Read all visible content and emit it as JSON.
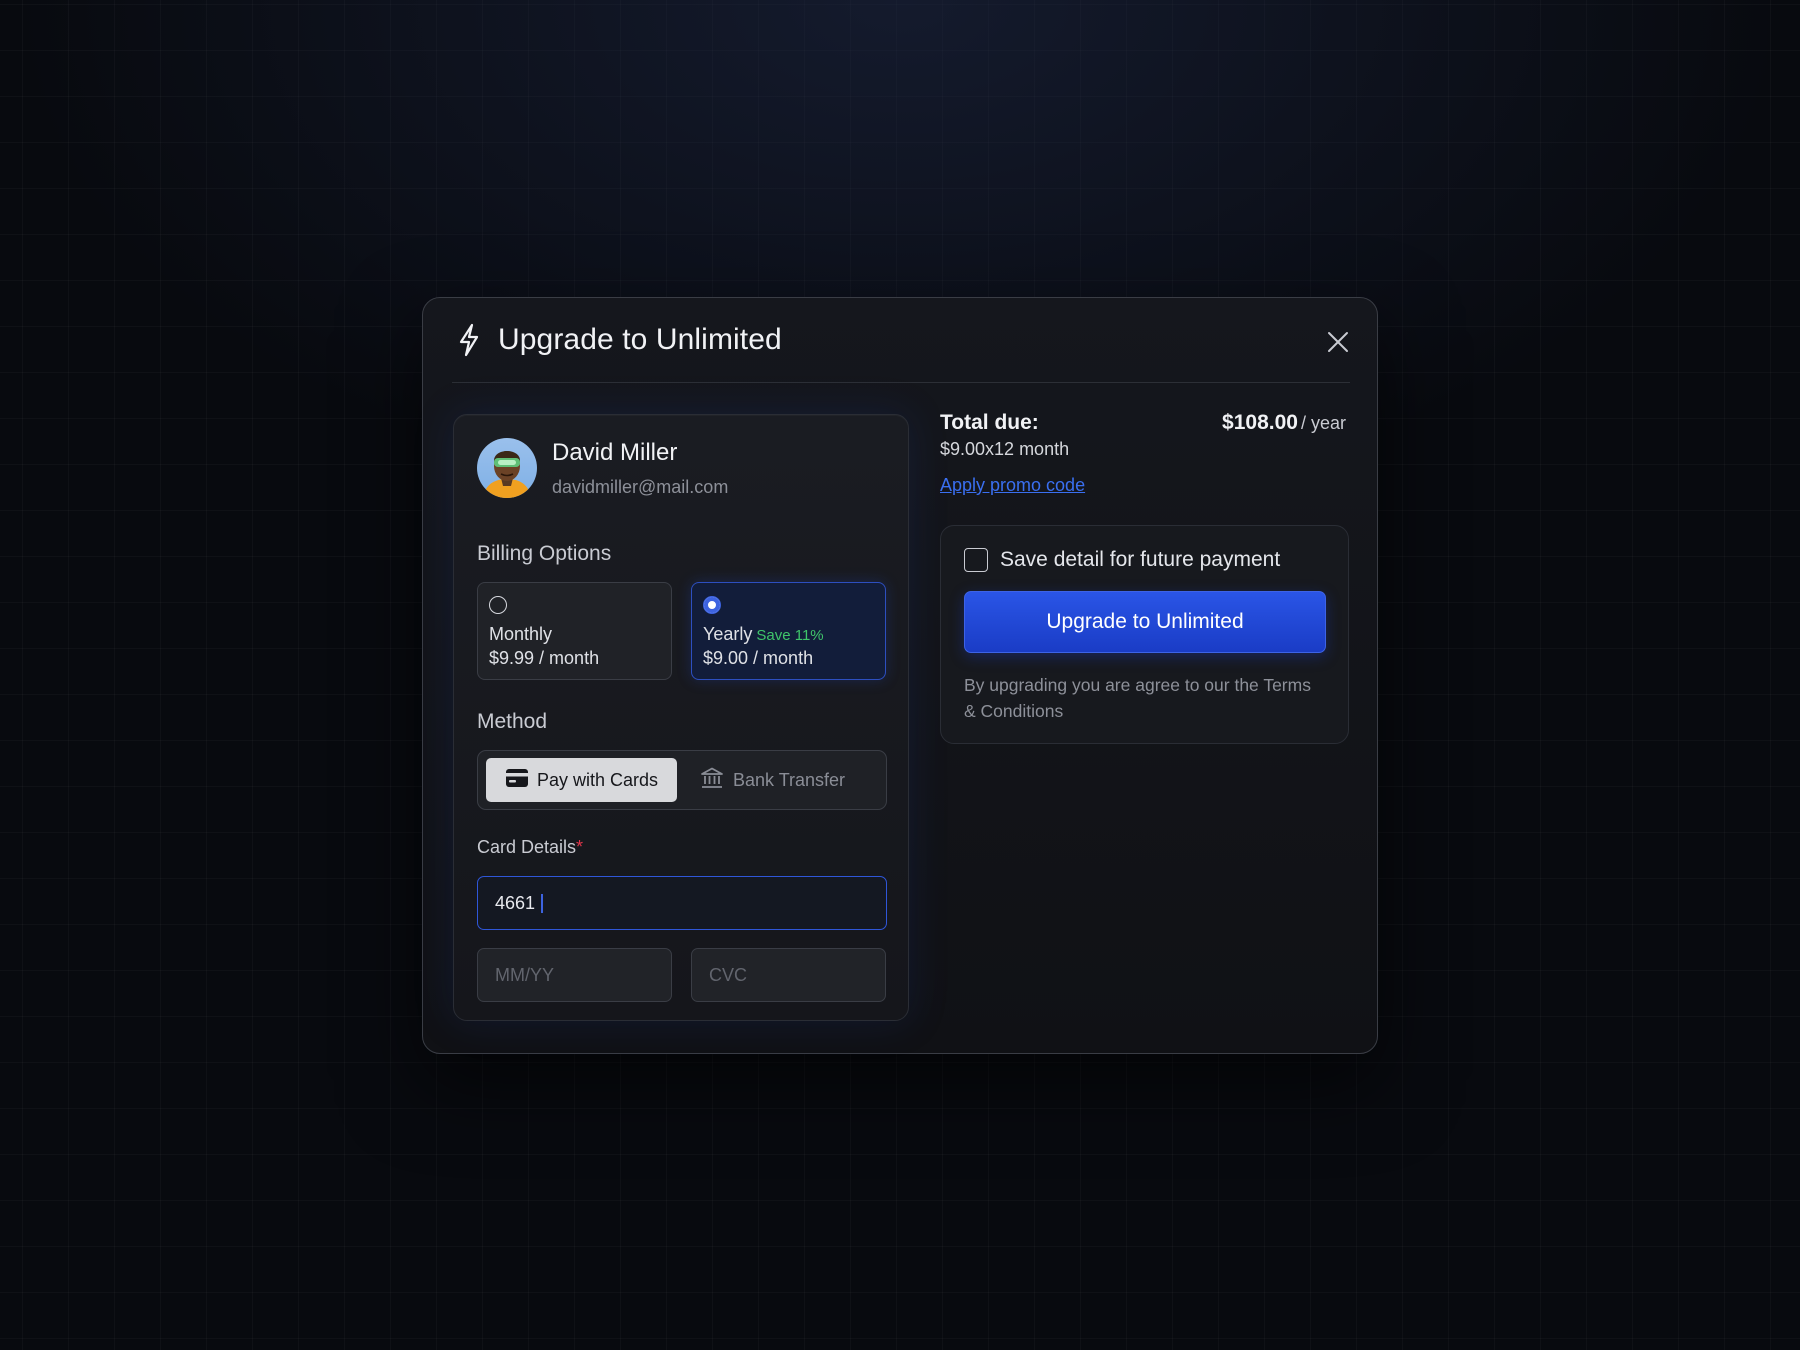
{
  "modal": {
    "title": "Upgrade to Unlimited",
    "icons": {
      "title": "bolt-icon",
      "close": "close-icon"
    }
  },
  "user": {
    "name": "David Miller",
    "email": "davidmiller@mail.com",
    "avatar_icon": "avatar-illustration"
  },
  "billing": {
    "label": "Billing Options",
    "options": [
      {
        "title": "Monthly",
        "price": "$9.99 / month",
        "badge": "",
        "selected": false
      },
      {
        "title": "Yearly",
        "price": "$9.00 / month",
        "badge": "Save 11%",
        "selected": true
      }
    ]
  },
  "method": {
    "label": "Method",
    "options": [
      {
        "label": "Pay with Cards",
        "icon": "credit-card-icon",
        "active": true
      },
      {
        "label": "Bank Transfer",
        "icon": "bank-icon",
        "active": false
      }
    ]
  },
  "card": {
    "label": "Card Details",
    "required_mark": "*",
    "number_value": "4661",
    "expiry_placeholder": "MM/YY",
    "cvc_placeholder": "CVC"
  },
  "summary": {
    "total_label": "Total due:",
    "total_breakdown": "$9.00x12 month",
    "total_amount": "$108.00",
    "total_unit": "/ year",
    "promo_link": "Apply promo code"
  },
  "checkout": {
    "save_label": "Save detail for future payment",
    "save_checked": false,
    "button_label": "Upgrade to Unlimited",
    "terms": "By upgrading you are agree to our the Terms & Conditions"
  },
  "colors": {
    "accent": "#2a55e6",
    "success": "#3fc46a",
    "required": "#e0354a",
    "link": "#3a6ff0"
  }
}
